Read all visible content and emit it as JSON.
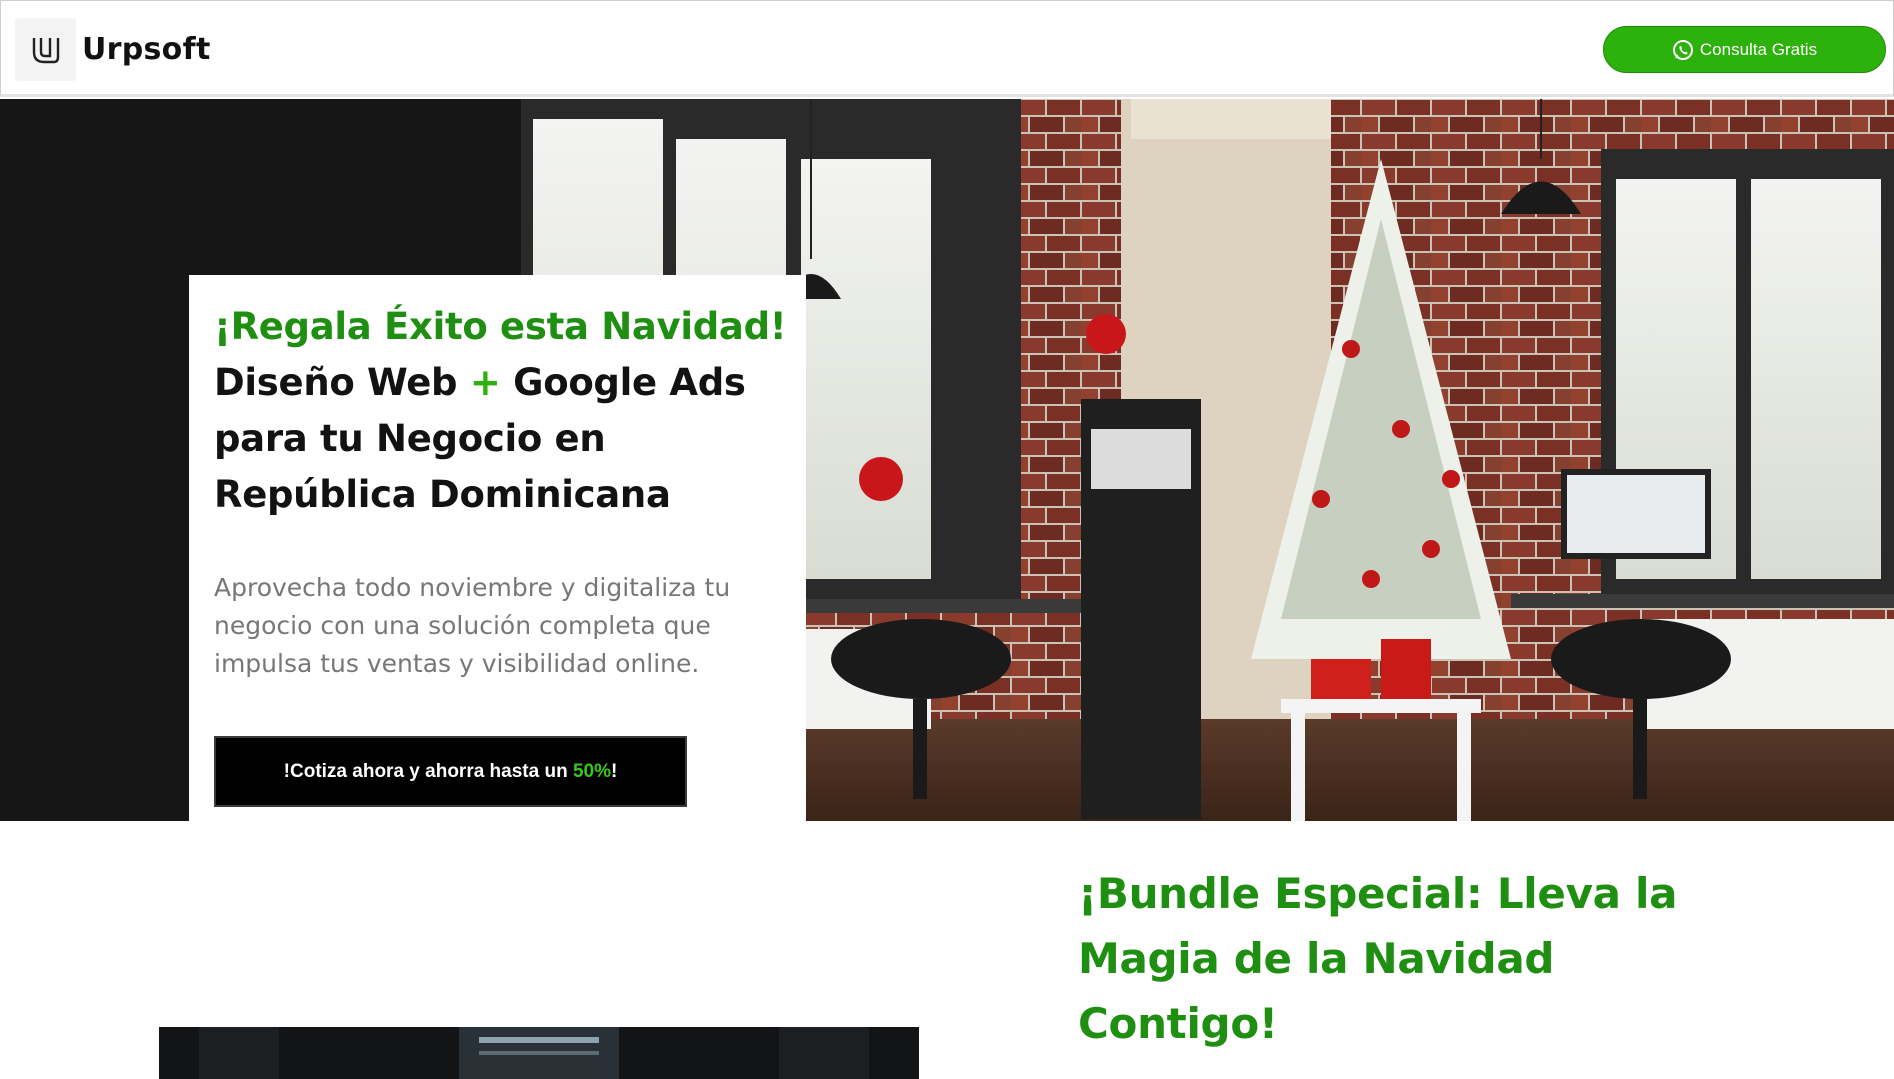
{
  "header": {
    "brand": "Urpsoft",
    "logo_icon": "urpsoft-u-logo-icon",
    "cta_label": "Consulta Gratis",
    "cta_icon": "whatsapp-icon",
    "cta_color": "#2db10c"
  },
  "hero": {
    "title_highlight": "¡Regala Éxito esta Navidad!",
    "title_part1": "Diseño Web",
    "title_plus": "+",
    "title_part2": "Google Ads para tu Negocio en República Dominicana",
    "description": "Aprovecha todo noviembre y digitaliza tu negocio con una solución completa que impulsa tus ventas y visibilidad online.",
    "cta_prefix": "!Cotiza ahora y ahorra hasta un",
    "cta_percent": "50%",
    "cta_suffix": "!",
    "image_alt": "christmas-office-photo",
    "accent_green": "#1f8f12"
  },
  "bundle": {
    "title": "¡Bundle Especial: Lleva la Magia de la Navidad Contigo!",
    "image_alt": "server-room-photo"
  }
}
